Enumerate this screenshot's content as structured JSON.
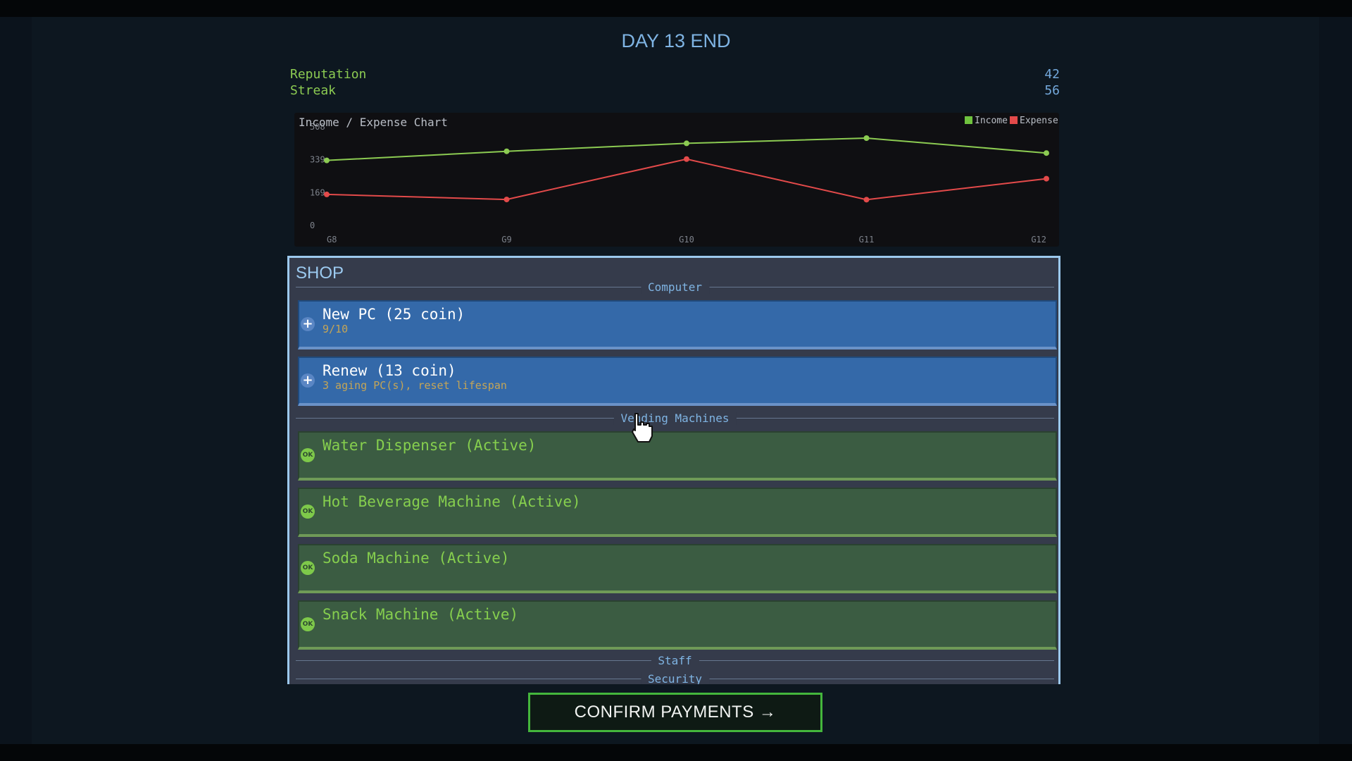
{
  "title": "DAY 13 END",
  "stats": [
    {
      "label": "Reputation",
      "value": "42"
    },
    {
      "label": "Streak",
      "value": "56"
    }
  ],
  "chart_data": {
    "type": "line",
    "title": "Income / Expense Chart",
    "categories": [
      "G8",
      "G9",
      "G10",
      "G11",
      "G12"
    ],
    "y_ticks": [
      "0",
      "169",
      "339",
      "508"
    ],
    "ylim": [
      0,
      508
    ],
    "series": [
      {
        "name": "Income",
        "color": "#8ccb52",
        "values": [
          335,
          382,
          423,
          450,
          373
        ]
      },
      {
        "name": "Expense",
        "color": "#e34a4a",
        "values": [
          160,
          134,
          342,
          133,
          241
        ]
      }
    ],
    "legend_position": "top-right",
    "grid": false
  },
  "shop": {
    "title": "SHOP",
    "sections": {
      "computer": "Computer",
      "vending": "Vending Machines",
      "staff": "Staff",
      "security": "Security"
    },
    "computer_items": [
      {
        "icon": "+",
        "name": "New PC (25 coin)",
        "sub": "9/10"
      },
      {
        "icon": "+",
        "name": "Renew (13 coin)",
        "sub": "3 aging PC(s), reset lifespan"
      }
    ],
    "vending_items": [
      {
        "icon": "OK",
        "name": "Water Dispenser (Active)"
      },
      {
        "icon": "OK",
        "name": "Hot Beverage Machine (Active)"
      },
      {
        "icon": "OK",
        "name": "Soda Machine (Active)"
      },
      {
        "icon": "OK",
        "name": "Snack Machine (Active)"
      }
    ]
  },
  "confirm_label": "CONFIRM PAYMENTS →",
  "colors": {
    "accent_blue": "#7fb4e3",
    "accent_green": "#8ccb52",
    "expense_red": "#e34a4a",
    "confirm_border": "#44b63c"
  }
}
